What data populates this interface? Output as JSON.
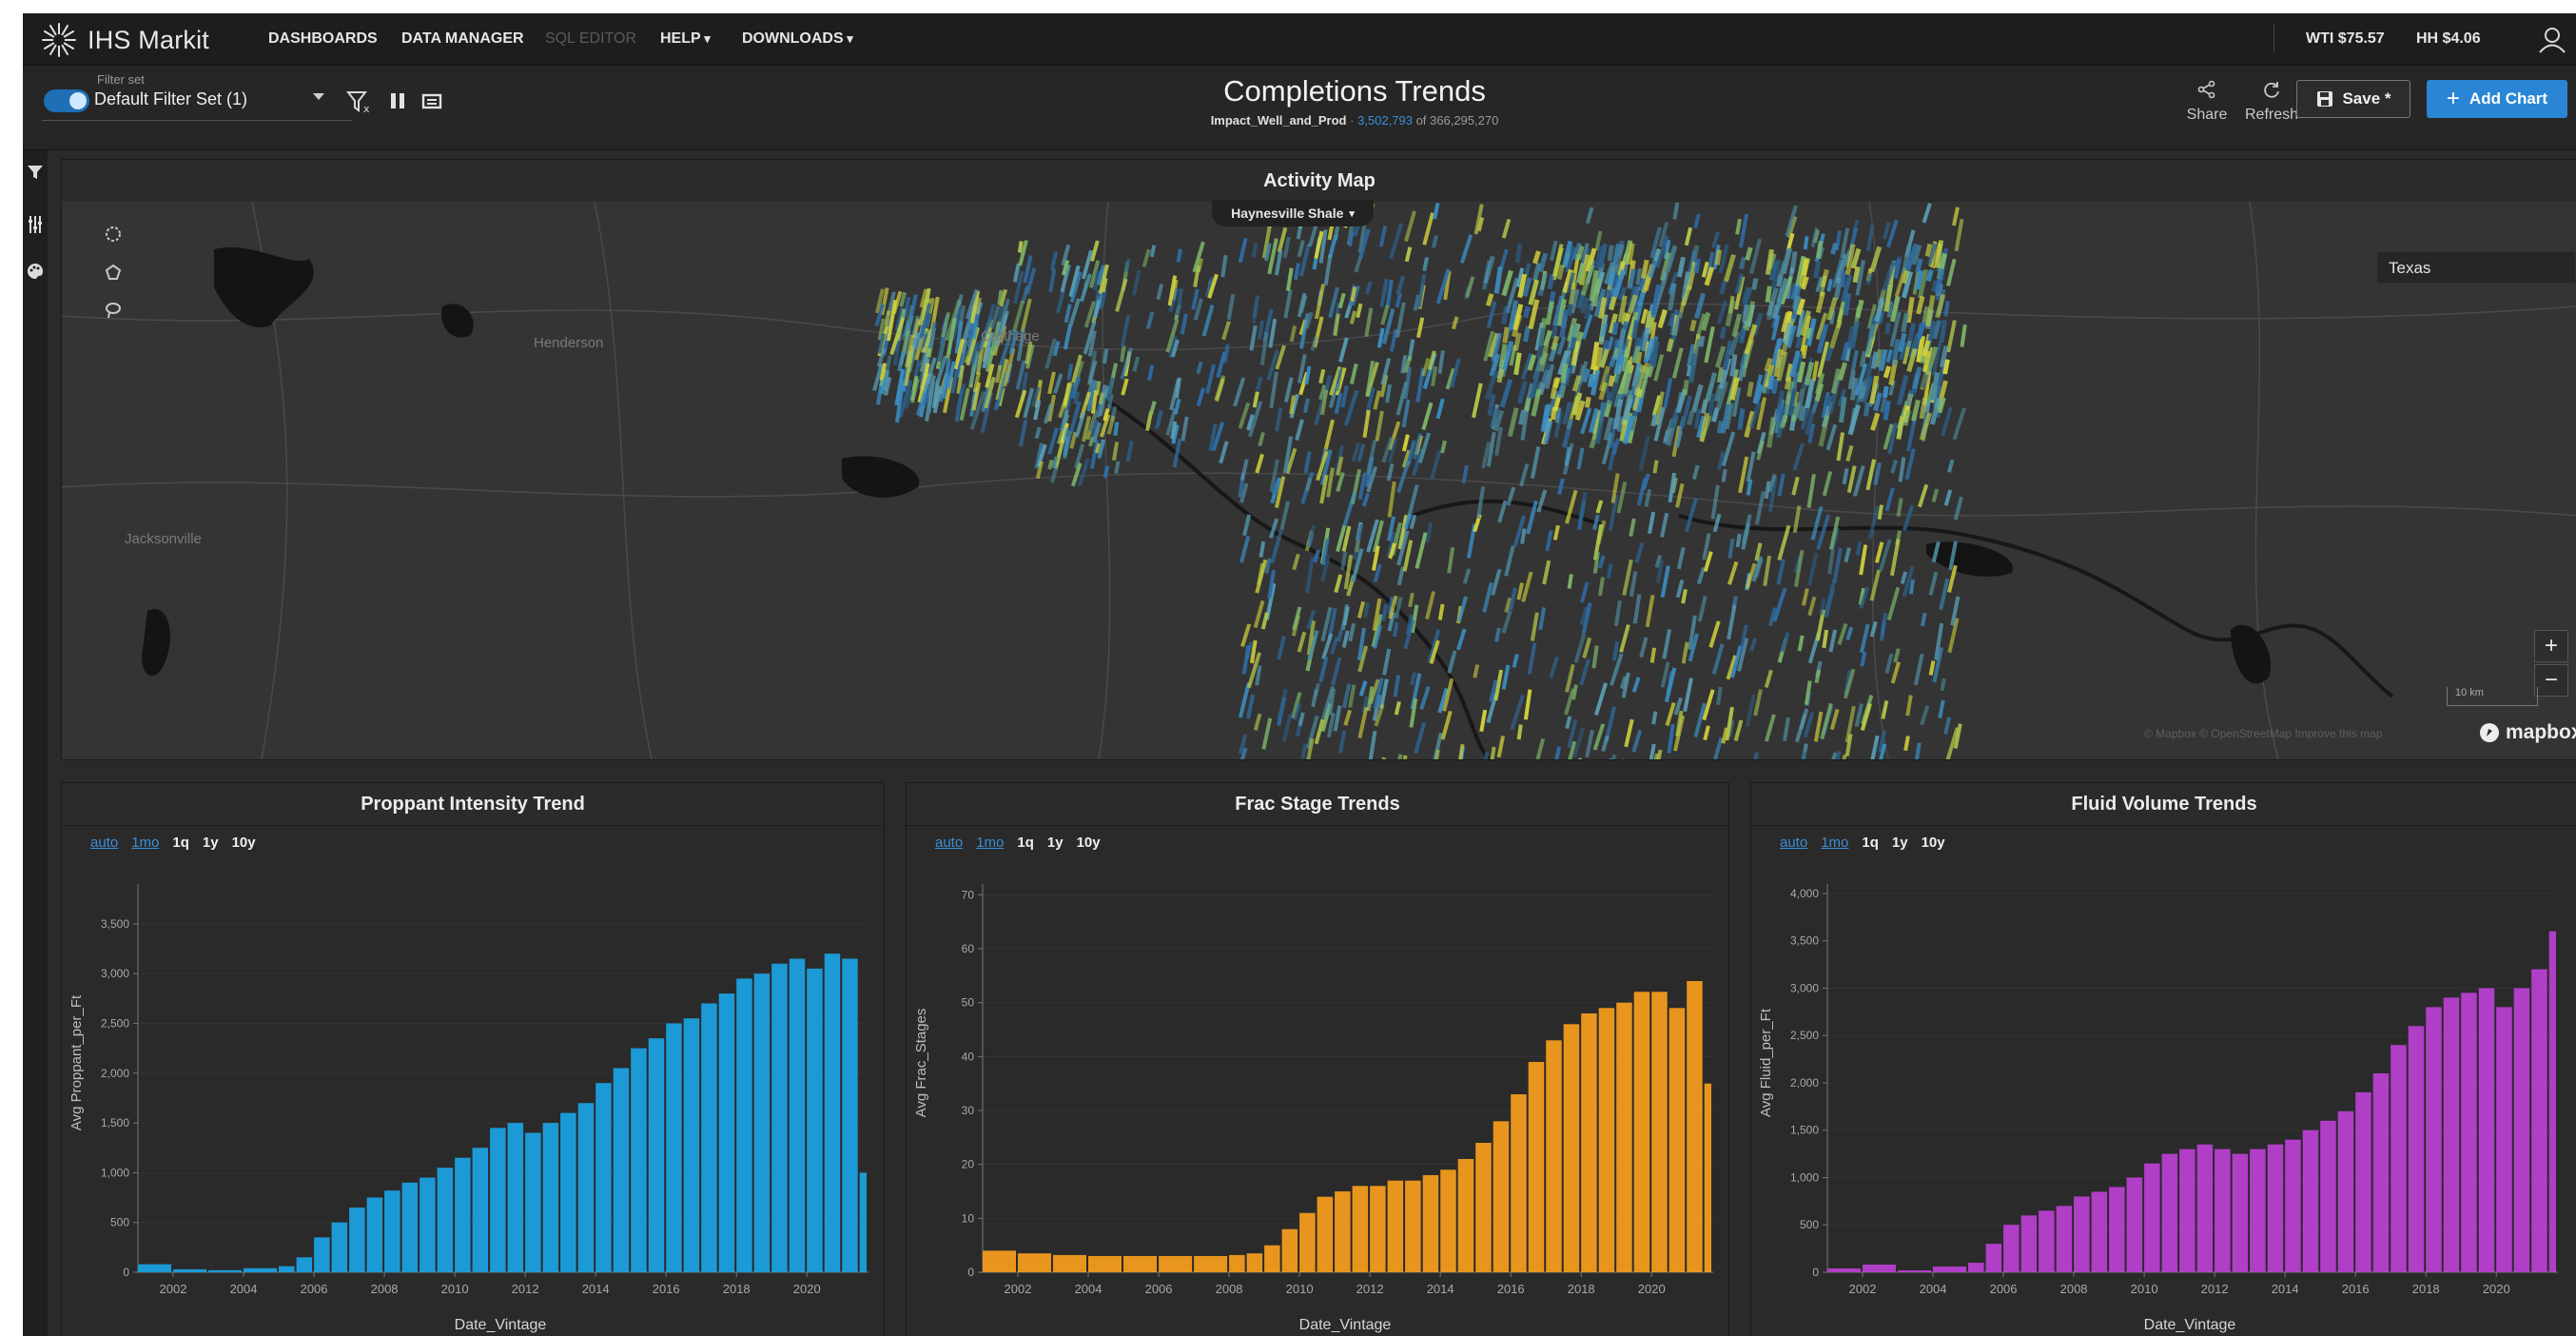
{
  "brand": {
    "name": "IHS Markit"
  },
  "nav": {
    "dashboards": "DASHBOARDS",
    "data_manager": "DATA MANAGER",
    "sql_editor": "SQL EDITOR",
    "help": "HELP",
    "downloads": "DOWNLOADS"
  },
  "prices": {
    "wti": "WTI $75.57",
    "hh": "HH $4.06"
  },
  "filter_set": {
    "label": "Filter set",
    "value": "Default Filter Set (1)"
  },
  "dashboard": {
    "title": "Completions Trends",
    "dataset": "Impact_Well_and_Prod",
    "separator": "·",
    "record_count": "3,502,793",
    "record_total": "of 366,295,270"
  },
  "actions": {
    "share": "Share",
    "refresh": "Refresh",
    "save": "Save *",
    "add_chart": "Add Chart"
  },
  "map": {
    "title": "Activity Map",
    "region": "Haynesville Shale",
    "search_value": "Texas",
    "places": [
      "Henderson",
      "Carthage",
      "Jacksonville"
    ],
    "scale": "10 km",
    "attribution": "© Mapbox  © OpenStreetMap  Improve this map",
    "provider": "mapbox",
    "zoom_in": "+",
    "zoom_out": "−"
  },
  "range_options": [
    "auto",
    "1mo",
    "1q",
    "1y",
    "10y"
  ],
  "colors": {
    "proppant": "#1c9ad6",
    "frac": "#e8951e",
    "fluid": "#b13ec7",
    "accent": "#2a86d4"
  },
  "charts": {
    "proppant": {
      "title": "Proppant Intensity Trend",
      "ylabel": "Avg Proppant_per_Ft",
      "xlabel": "Date_Vintage"
    },
    "frac": {
      "title": "Frac Stage Trends",
      "ylabel": "Avg Frac_Stages",
      "xlabel": "Date_Vintage"
    },
    "fluid": {
      "title": "Fluid Volume Trends",
      "ylabel": "Avg Fluid_per_Ft",
      "xlabel": "Date_Vintage"
    }
  },
  "chart_data": [
    {
      "type": "bar",
      "title": "Proppant Intensity Trend",
      "xlabel": "Date_Vintage",
      "ylabel": "Avg Proppant_per_Ft",
      "x_ticks": [
        "2002",
        "2004",
        "2006",
        "2008",
        "2010",
        "2012",
        "2014",
        "2016",
        "2018",
        "2020"
      ],
      "y_ticks": [
        "0",
        "500",
        "1,000",
        "1,500",
        "2,000",
        "2,500",
        "3,000",
        "3,500"
      ],
      "ylim": [
        0,
        3900
      ],
      "xlim": [
        2001.0,
        2021.75
      ],
      "color": "#1c9ad6",
      "x": [
        2001.0,
        2002.0,
        2003.0,
        2004.0,
        2005.0,
        2005.5,
        2006.0,
        2006.5,
        2007.0,
        2007.5,
        2008.0,
        2008.5,
        2009.0,
        2009.5,
        2010.0,
        2010.5,
        2011.0,
        2011.5,
        2012.0,
        2012.5,
        2013.0,
        2013.5,
        2014.0,
        2014.5,
        2015.0,
        2015.5,
        2016.0,
        2016.5,
        2017.0,
        2017.5,
        2018.0,
        2018.5,
        2019.0,
        2019.5,
        2020.0,
        2020.5,
        2021.0,
        2021.5
      ],
      "values": [
        80,
        30,
        20,
        40,
        60,
        150,
        350,
        500,
        650,
        750,
        820,
        900,
        950,
        1050,
        1150,
        1250,
        1450,
        1500,
        1400,
        1500,
        1600,
        1700,
        1900,
        2050,
        2250,
        2350,
        2500,
        2550,
        2700,
        2800,
        2950,
        3000,
        3100,
        3150,
        3050,
        3200,
        3150,
        1000
      ]
    },
    {
      "type": "bar",
      "title": "Frac Stage Trends",
      "xlabel": "Date_Vintage",
      "ylabel": "Avg Frac_Stages",
      "x_ticks": [
        "2002",
        "2004",
        "2006",
        "2008",
        "2010",
        "2012",
        "2014",
        "2016",
        "2018",
        "2020"
      ],
      "y_ticks": [
        "0",
        "10",
        "20",
        "30",
        "40",
        "50",
        "60",
        "70"
      ],
      "ylim": [
        0,
        72
      ],
      "xlim": [
        2001.0,
        2021.75
      ],
      "color": "#e8951e",
      "x": [
        2001.0,
        2002.0,
        2003.0,
        2004.0,
        2005.0,
        2006.0,
        2007.0,
        2008.0,
        2008.5,
        2009.0,
        2009.5,
        2010.0,
        2010.5,
        2011.0,
        2011.5,
        2012.0,
        2012.5,
        2013.0,
        2013.5,
        2014.0,
        2014.5,
        2015.0,
        2015.5,
        2016.0,
        2016.5,
        2017.0,
        2017.5,
        2018.0,
        2018.5,
        2019.0,
        2019.5,
        2020.0,
        2020.5,
        2021.0,
        2021.5
      ],
      "values": [
        4,
        3.5,
        3.2,
        3,
        3,
        3,
        3,
        3.2,
        3.5,
        5,
        8,
        11,
        14,
        15,
        16,
        16,
        17,
        17,
        18,
        19,
        21,
        24,
        28,
        33,
        39,
        43,
        46,
        48,
        49,
        50,
        52,
        52,
        49,
        54,
        35
      ]
    },
    {
      "type": "bar",
      "title": "Fluid Volume Trends",
      "xlabel": "Date_Vintage",
      "ylabel": "Avg Fluid_per_Ft",
      "x_ticks": [
        "2002",
        "2004",
        "2006",
        "2008",
        "2010",
        "2012",
        "2014",
        "2016",
        "2018",
        "2020"
      ],
      "y_ticks": [
        "0",
        "500",
        "1,000",
        "1,500",
        "2,000",
        "2,500",
        "3,000",
        "3,500",
        "4,000"
      ],
      "ylim": [
        0,
        4100
      ],
      "xlim": [
        2001.0,
        2021.75
      ],
      "color": "#b13ec7",
      "x": [
        2001.0,
        2002.0,
        2003.0,
        2004.0,
        2005.0,
        2005.5,
        2006.0,
        2006.5,
        2007.0,
        2007.5,
        2008.0,
        2008.5,
        2009.0,
        2009.5,
        2010.0,
        2010.5,
        2011.0,
        2011.5,
        2012.0,
        2012.5,
        2013.0,
        2013.5,
        2014.0,
        2014.5,
        2015.0,
        2015.5,
        2016.0,
        2016.5,
        2017.0,
        2017.5,
        2018.0,
        2018.5,
        2019.0,
        2019.5,
        2020.0,
        2020.5,
        2021.0,
        2021.5
      ],
      "values": [
        40,
        80,
        20,
        60,
        100,
        300,
        500,
        600,
        650,
        700,
        800,
        850,
        900,
        1000,
        1150,
        1250,
        1300,
        1350,
        1300,
        1250,
        1300,
        1350,
        1400,
        1500,
        1600,
        1700,
        1900,
        2100,
        2400,
        2600,
        2800,
        2900,
        2950,
        3000,
        2800,
        3000,
        3200,
        3600
      ]
    }
  ]
}
